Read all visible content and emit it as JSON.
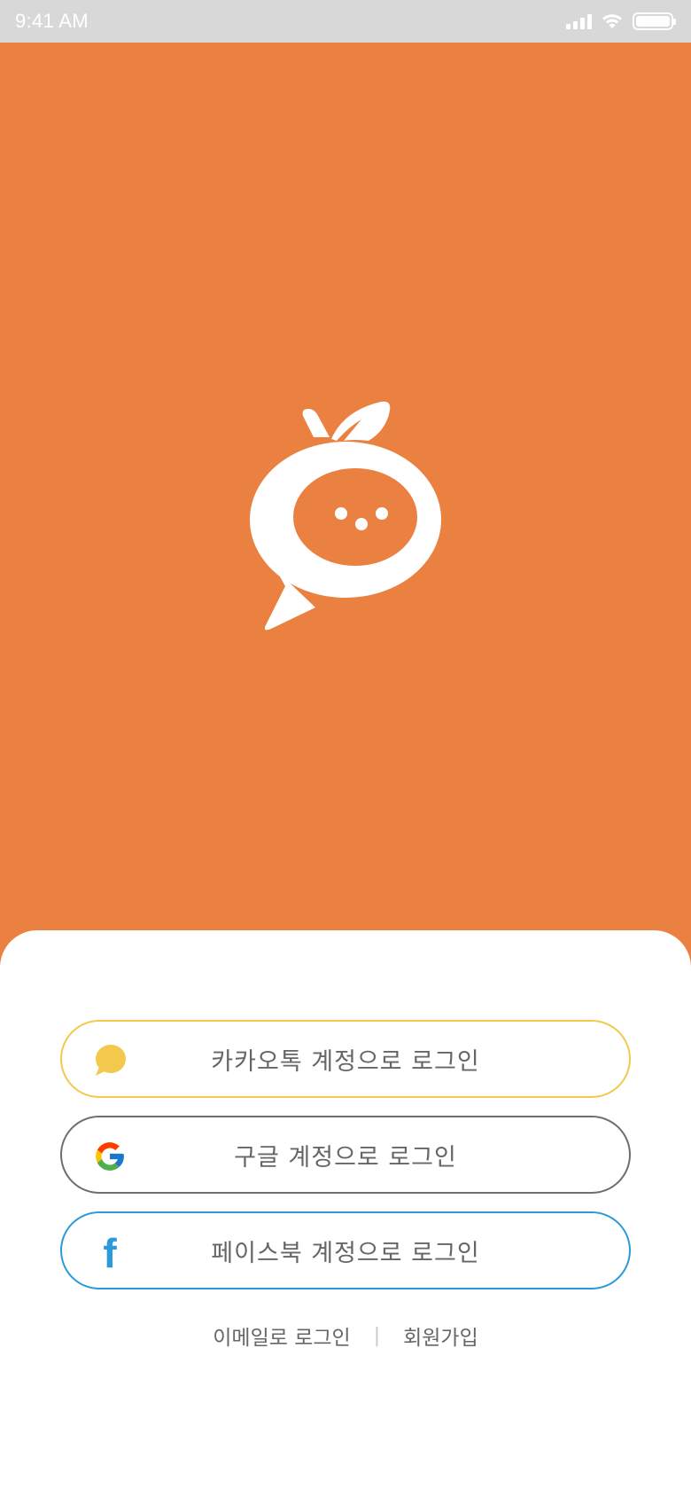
{
  "status_bar": {
    "time": "9:41 AM"
  },
  "colors": {
    "brand": "#ea8141",
    "kakao": "#f2c94c",
    "google_border": "#6e6e6e",
    "facebook": "#2b9ad8"
  },
  "logo": {
    "icon": "tangerine-chat-bubble-icon"
  },
  "login": {
    "kakao": {
      "label": "카카오톡 계정으로 로그인",
      "icon": "kakao-icon"
    },
    "google": {
      "label": "구글 계정으로 로그인",
      "icon": "google-icon"
    },
    "facebook": {
      "label": "페이스북 계정으로 로그인",
      "icon": "facebook-icon"
    }
  },
  "links": {
    "email_login": "이메일로 로그인",
    "separator": "|",
    "signup": "회원가입"
  }
}
